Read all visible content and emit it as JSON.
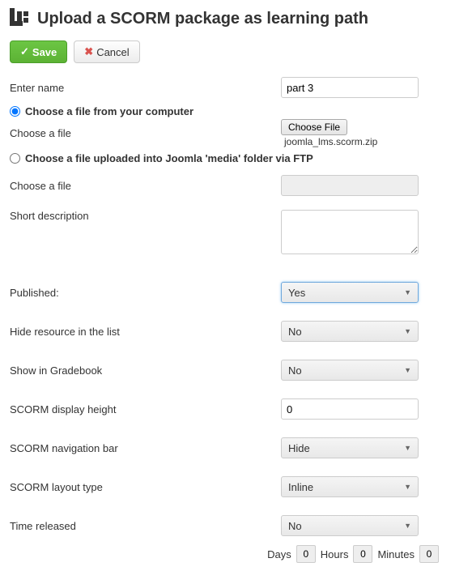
{
  "header": {
    "title": "Upload a SCORM package as learning path"
  },
  "toolbar": {
    "save_label": "Save",
    "cancel_label": "Cancel"
  },
  "form": {
    "enter_name_label": "Enter name",
    "enter_name_value": "part 3",
    "radio_computer_label": "Choose a file from your computer",
    "choose_file_label": "Choose a file",
    "choose_file_button": "Choose File",
    "chosen_file_name": "joomla_lms.scorm.zip",
    "radio_ftp_label": "Choose a file uploaded into Joomla 'media' folder via FTP",
    "choose_file2_label": "Choose a file",
    "choose_file2_value": "",
    "short_desc_label": "Short description",
    "short_desc_value": "",
    "published_label": "Published:",
    "published_value": "Yes",
    "hide_resource_label": "Hide resource in the list",
    "hide_resource_value": "No",
    "gradebook_label": "Show in Gradebook",
    "gradebook_value": "No",
    "display_height_label": "SCORM display height",
    "display_height_value": "0",
    "nav_bar_label": "SCORM navigation bar",
    "nav_bar_value": "Hide",
    "layout_label": "SCORM layout type",
    "layout_value": "Inline",
    "time_released_label": "Time released",
    "time_released_value": "No",
    "days_label": "Days",
    "days_value": "0",
    "hours_label": "Hours",
    "hours_value": "0",
    "minutes_label": "Minutes",
    "minutes_value": "0"
  }
}
